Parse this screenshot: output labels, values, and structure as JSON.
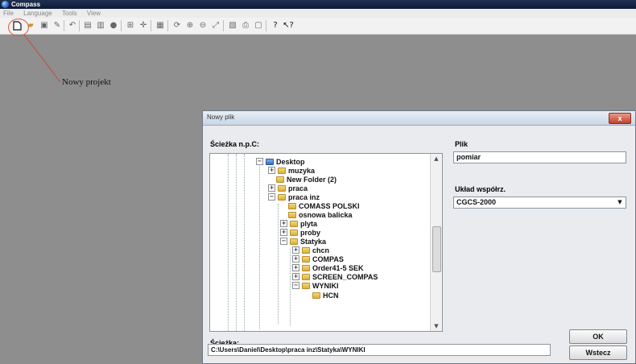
{
  "window": {
    "title": "Compass"
  },
  "menu": [
    "File",
    "Language",
    "Tools",
    "View"
  ],
  "toolbar": {
    "icons": [
      "new-project-icon",
      "open-folder-icon",
      "save-icon",
      "tool-icon",
      "undo-icon",
      "print-icon",
      "print-preview-icon",
      "record-icon",
      "grid-icon",
      "crosshair-icon",
      "layers-icon",
      "refresh-icon",
      "zoom-in-icon",
      "zoom-out-icon",
      "zoom-extents-icon",
      "filter-icon",
      "printer-icon",
      "page-preview-icon",
      "help-icon",
      "context-help-icon"
    ]
  },
  "annotation": {
    "label": "Nowy projekt"
  },
  "dialog": {
    "title": "Nowy plik",
    "close_label": "x",
    "path_np_label": "Ścieżka n.p.C:",
    "tree": [
      {
        "label": "Desktop",
        "expander": "−",
        "folder": "desktop"
      },
      {
        "label": "muzyka",
        "expander": "+",
        "folder": "folder"
      },
      {
        "label": "New Folder (2)",
        "expander": "",
        "folder": "folder"
      },
      {
        "label": "praca",
        "expander": "+",
        "folder": "folder"
      },
      {
        "label": "praca inz",
        "expander": "−",
        "folder": "folder"
      },
      {
        "label": "COMASS POLSKI",
        "expander": "",
        "folder": "folder"
      },
      {
        "label": "osnowa balicka",
        "expander": "",
        "folder": "folder"
      },
      {
        "label": "plyta",
        "expander": "+",
        "folder": "folder"
      },
      {
        "label": "proby",
        "expander": "+",
        "folder": "folder"
      },
      {
        "label": "Statyka",
        "expander": "−",
        "folder": "folder"
      },
      {
        "label": "chcn",
        "expander": "+",
        "folder": "folder"
      },
      {
        "label": "COMPAS",
        "expander": "+",
        "folder": "folder"
      },
      {
        "label": "Order41-5 SEK",
        "expander": "+",
        "folder": "folder"
      },
      {
        "label": "SCREEN_COMPAS",
        "expander": "+",
        "folder": "folder"
      },
      {
        "label": "WYNIKI",
        "expander": "−",
        "folder": "folder"
      },
      {
        "label": "HCN",
        "expander": "",
        "folder": "folder"
      }
    ],
    "plik_label": "Plik",
    "plik_value": "pomiar",
    "uklad_label": "Układ współrz.",
    "uklad_value": "CGCS-2000",
    "sciezka_label": "Ścieżka:",
    "sciezka_value": "C:\\Users\\Daniel\\Desktop\\praca inz\\Statyka\\WYNIKI",
    "ok_label": "OK",
    "cancel_label": "Wstecz"
  }
}
